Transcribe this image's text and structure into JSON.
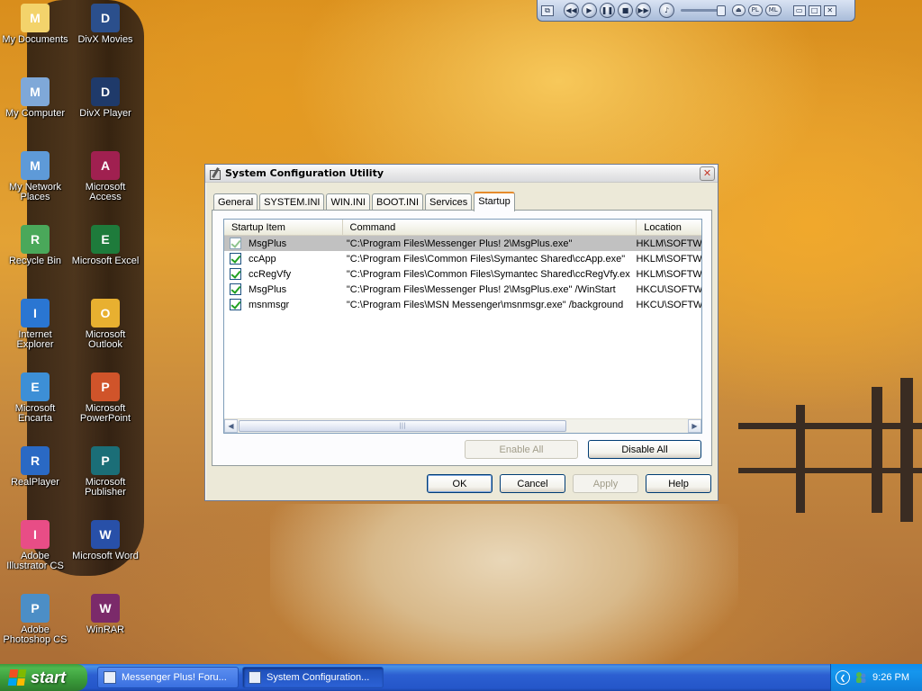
{
  "desktop": {
    "icons": [
      {
        "label": "My Documents",
        "icon": "folder-documents-icon",
        "color": "#f3d36b"
      },
      {
        "label": "DivX Movies",
        "icon": "divx-movies-icon",
        "color": "#2b4f8c"
      },
      {
        "label": "My Computer",
        "icon": "computer-icon",
        "color": "#7fa8d8"
      },
      {
        "label": "DivX Player",
        "icon": "divx-player-icon",
        "color": "#1f3a6a"
      },
      {
        "label": "My Network Places",
        "icon": "network-places-icon",
        "color": "#5e9ad8"
      },
      {
        "label": "Microsoft Access",
        "icon": "access-icon",
        "color": "#a02050"
      },
      {
        "label": "Recycle Bin",
        "icon": "recycle-bin-icon",
        "color": "#4aa85a"
      },
      {
        "label": "Microsoft Excel",
        "icon": "excel-icon",
        "color": "#1e7b3b"
      },
      {
        "label": "Internet Explorer",
        "icon": "internet-explorer-icon",
        "color": "#2a76d2"
      },
      {
        "label": "Microsoft Outlook",
        "icon": "outlook-icon",
        "color": "#e8b030"
      },
      {
        "label": "Microsoft Encarta",
        "icon": "encarta-icon",
        "color": "#3d8fd6"
      },
      {
        "label": "Microsoft PowerPoint",
        "icon": "powerpoint-icon",
        "color": "#d0542a"
      },
      {
        "label": "RealPlayer",
        "icon": "realplayer-icon",
        "color": "#2a69c4"
      },
      {
        "label": "Microsoft Publisher",
        "icon": "publisher-icon",
        "color": "#1b6e77"
      },
      {
        "label": "Adobe Illustrator CS",
        "icon": "illustrator-icon",
        "color": "#e84d86"
      },
      {
        "label": "Microsoft Word",
        "icon": "word-icon",
        "color": "#2850a8"
      },
      {
        "label": "Adobe Photoshop CS",
        "icon": "photoshop-icon",
        "color": "#4c8ec6"
      },
      {
        "label": "WinRAR",
        "icon": "winrar-icon",
        "color": "#7b2a6a"
      }
    ]
  },
  "media_bar": {
    "buttons": [
      "◀◀",
      "▶",
      "❚❚",
      "■",
      "▶▶"
    ],
    "pills": [
      "⏏",
      "PL",
      "ML"
    ]
  },
  "dialog": {
    "title": "System Configuration Utility",
    "close_label": "✕",
    "tabs": [
      "General",
      "SYSTEM.INI",
      "WIN.INI",
      "BOOT.INI",
      "Services",
      "Startup"
    ],
    "active_tab": "Startup",
    "columns": [
      "Startup Item",
      "Command",
      "Location"
    ],
    "rows": [
      {
        "item": "MsgPlus",
        "command": "\"C:\\Program Files\\Messenger Plus! 2\\MsgPlus.exe\"",
        "location": "HKLM\\SOFTW",
        "checked": true,
        "selected": true
      },
      {
        "item": "ccApp",
        "command": "\"C:\\Program Files\\Common Files\\Symantec Shared\\ccApp.exe\"",
        "location": "HKLM\\SOFTW",
        "checked": true,
        "selected": false
      },
      {
        "item": "ccRegVfy",
        "command": "\"C:\\Program Files\\Common Files\\Symantec Shared\\ccRegVfy.exe\"",
        "location": "HKLM\\SOFTW",
        "checked": true,
        "selected": false
      },
      {
        "item": "MsgPlus",
        "command": "\"C:\\Program Files\\Messenger Plus! 2\\MsgPlus.exe\" /WinStart",
        "location": "HKCU\\SOFTW",
        "checked": true,
        "selected": false
      },
      {
        "item": "msnmsgr",
        "command": "\"C:\\Program Files\\MSN Messenger\\msnmsgr.exe\" /background",
        "location": "HKCU\\SOFTW",
        "checked": true,
        "selected": false
      }
    ],
    "scroll_left": "◀",
    "scroll_right": "▶",
    "scroll_grip": "|||",
    "enable_all": "Enable All",
    "disable_all": "Disable All",
    "ok": "OK",
    "cancel": "Cancel",
    "apply": "Apply",
    "help": "Help"
  },
  "taskbar": {
    "start_label": "start",
    "tasks": [
      {
        "label": "Messenger Plus! Foru...",
        "active": false
      },
      {
        "label": "System Configuration...",
        "active": true
      }
    ],
    "tray_arrow": "❮",
    "clock": "9:26 PM"
  },
  "colors": {
    "accent_tab": "#e68b2c",
    "taskbar": "#2456c9",
    "start": "#3a9a3a",
    "check": "#21a121"
  }
}
